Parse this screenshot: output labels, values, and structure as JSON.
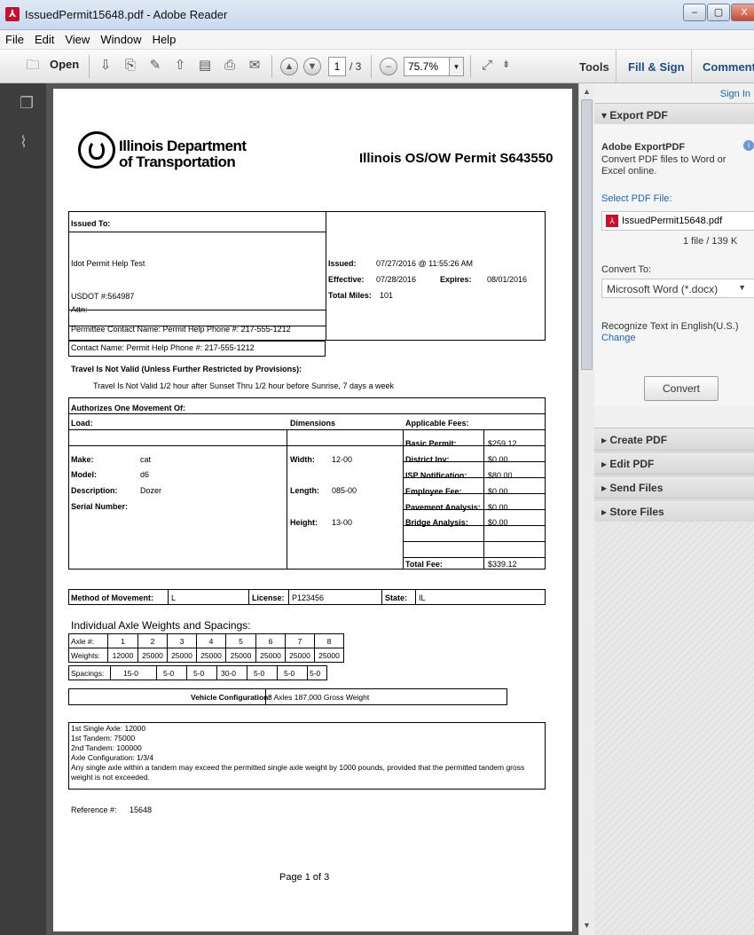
{
  "window": {
    "title": "IssuedPermit15648.pdf - Adobe Reader",
    "controls": {
      "minimize": "–",
      "maximize": "▢",
      "close": "X"
    }
  },
  "menu": [
    "File",
    "Edit",
    "View",
    "Window",
    "Help"
  ],
  "toolbar": {
    "open_label": "Open",
    "page_current": "1",
    "page_total": "/ 3",
    "zoom": "75.7%",
    "tools_label": "Tools",
    "fill_sign_label": "Fill & Sign",
    "comment_label": "Comment"
  },
  "right_pane": {
    "sign_in": "Sign In",
    "export_header": "▾ Export PDF",
    "export_title": "Adobe ExportPDF",
    "export_desc": "Convert PDF files to Word or Excel online.",
    "select_file_label": "Select PDF File:",
    "file_name": "IssuedPermit15648.pdf",
    "file_count": "1 file / 139 K",
    "convert_to_label": "Convert To:",
    "convert_to_value": "Microsoft Word (*.docx)",
    "recognize_text": "Recognize Text in English(U.S.)",
    "change_link": "Change",
    "convert_button": "Convert",
    "sections": [
      "▸ Create PDF",
      "▸ Edit PDF",
      "▸ Send Files",
      "▸ Store Files"
    ]
  },
  "doc": {
    "org_line1": "Illinois Department",
    "org_line2": "of Transportation",
    "permit_title": "Illinois OS/OW Permit S643550",
    "issued_to_label": "Issued To:",
    "issued_to_name": "Idot Permit Help Test",
    "usdot": "USDOT #:564987",
    "attn": "Attn:",
    "permittee_contact": "Permittee Contact Name: Permit Help  Phone #: 217-555-1212",
    "contact_name": "Contact Name: Permit Help  Phone #: 217-555-1212",
    "issued_label": "Issued:",
    "issued_value": "07/27/2016 @ 11:55:26 AM",
    "effective_label": "Effective:",
    "effective_value": "07/28/2016",
    "expires_label": "Expires:",
    "expires_value": "08/01/2016",
    "total_miles_label": "Total Miles:",
    "total_miles_value": "101",
    "travel_heading": "Travel Is Not Valid (Unless Further Restricted by Provisions):",
    "travel_text": "Travel Is Not Valid 1/2 hour after Sunset Thru 1/2 hour before Sunrise, 7 days a week",
    "authorizes": "Authorizes One Movement Of:",
    "load_label": "Load:",
    "dimensions_label": "Dimensions",
    "fees_label": "Applicable Fees:",
    "load": [
      {
        "label": "Make:",
        "value": "cat"
      },
      {
        "label": "Model:",
        "value": "d6"
      },
      {
        "label": "Description:",
        "value": "Dozer"
      },
      {
        "label": "Serial Number:",
        "value": ""
      }
    ],
    "dims": [
      {
        "label": "Width:",
        "value": "12-00"
      },
      {
        "label": "Length:",
        "value": "085-00"
      },
      {
        "label": "Height:",
        "value": "13-00"
      }
    ],
    "fees": [
      {
        "label": "Basic Permit:",
        "value": "$259.12"
      },
      {
        "label": "District Inv:",
        "value": "$0.00"
      },
      {
        "label": "ISP Notification:",
        "value": "$80.00"
      },
      {
        "label": "Employee Fee:",
        "value": "$0.00"
      },
      {
        "label": "Pavement Analysis:",
        "value": "$0.00"
      },
      {
        "label": "Bridge Analysis:",
        "value": "$0.00"
      }
    ],
    "total_fee_label": "Total Fee:",
    "total_fee_value": "$339.12",
    "method_label": "Method of Movement:",
    "method_value": "L",
    "license_label": "License:",
    "license_value": "P123456",
    "state_label": "State:",
    "state_value": "IL",
    "axle_heading": "Individual Axle Weights and Spacings:",
    "axle_label": "Axle #:",
    "axle_numbers": [
      "1",
      "2",
      "3",
      "4",
      "5",
      "6",
      "7",
      "8"
    ],
    "weights_label": "Weights:",
    "weights": [
      "12000",
      "25000",
      "25000",
      "25000",
      "25000",
      "25000",
      "25000",
      "25000"
    ],
    "spacings_label": "Spacings:",
    "spacings": [
      "15-0",
      "5-0",
      "5-0",
      "30-0",
      "5-0",
      "5-0",
      "5-0"
    ],
    "vehicle_config_label": "Vehicle Configuration:",
    "vehicle_config_value": "8 Axles  187,000 Gross Weight",
    "notes": [
      "1st Single Axle: 12000",
      "1st Tandem: 75000",
      "2nd Tandem: 100000",
      "Axle Configuration: 1/3/4",
      "Any single axle within a tandem may exceed the permitted single axle weight by 1000 pounds, provided that the permitted tandem gross",
      "weight is not exceeded."
    ],
    "reference_label": "Reference #:",
    "reference_value": "15648",
    "page_footer": "Page 1 of 3"
  }
}
